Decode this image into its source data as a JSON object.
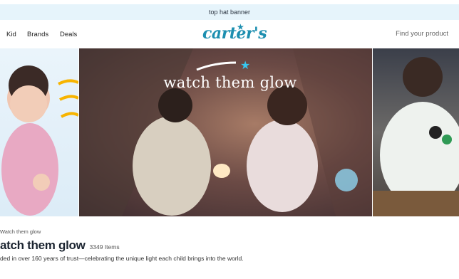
{
  "banner": {
    "text": "top hat banner"
  },
  "nav": {
    "items": [
      "Kid",
      "Brands",
      "Deals"
    ],
    "logo_text": "carter's",
    "search_placeholder": "Find your product"
  },
  "hero": {
    "headline": "watch them glow"
  },
  "breadcrumb": {
    "text": "Watch them glow"
  },
  "page": {
    "title": "atch them glow",
    "count": "3349 Items",
    "description": "ded in over 160 years of trust—celebrating the unique light each child brings into the world."
  },
  "colors": {
    "banner_bg": "#e6f4fb",
    "brand_blue": "#1d8fb0",
    "star_cyan": "#37c6ee"
  }
}
